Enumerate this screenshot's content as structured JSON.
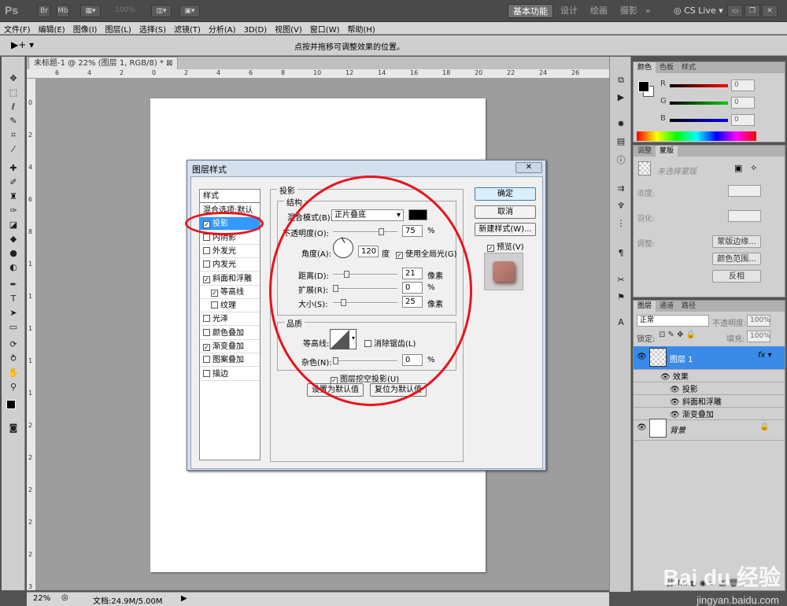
{
  "app": {
    "logo": "Ps",
    "zoom_selector": "100%",
    "workspaces": [
      "基本功能",
      "设计",
      "绘画",
      "摄影"
    ],
    "cs_live": "CS Live"
  },
  "menu": [
    "文件(F)",
    "编辑(E)",
    "图像(I)",
    "图层(L)",
    "选择(S)",
    "滤镜(T)",
    "分析(A)",
    "3D(D)",
    "视图(V)",
    "窗口(W)",
    "帮助(H)"
  ],
  "options_bar": {
    "hint": "点按并拖移可调整效果的位置。"
  },
  "document": {
    "tab_title": "未标题-1 @ 22% (图层 1, RGB/8) *",
    "ruler_h": [
      "6",
      "4",
      "2",
      "0",
      "2",
      "4",
      "6",
      "8",
      "10",
      "12",
      "14",
      "16",
      "18",
      "20",
      "22",
      "24",
      "26"
    ],
    "ruler_v": [
      "0",
      "2",
      "4",
      "6",
      "8",
      "1",
      "1",
      "1",
      "1",
      "1",
      "2",
      "2",
      "2",
      "2",
      "2",
      "3"
    ]
  },
  "status": {
    "zoom": "22%",
    "doc": "文档:24.9M/5.00M"
  },
  "dialog": {
    "title": "图层样式",
    "styles_header": "样式",
    "styles": [
      {
        "label": "混合选项:默认",
        "check": false,
        "has_box": false
      },
      {
        "label": "投影",
        "check": true,
        "has_box": true,
        "selected": true
      },
      {
        "label": "内阴影",
        "check": false,
        "has_box": true
      },
      {
        "label": "外发光",
        "check": false,
        "has_box": true
      },
      {
        "label": "内发光",
        "check": false,
        "has_box": true
      },
      {
        "label": "斜面和浮雕",
        "check": true,
        "has_box": true
      },
      {
        "label": "等高线",
        "check": true,
        "has_box": true,
        "indent": true
      },
      {
        "label": "纹理",
        "check": false,
        "has_box": true,
        "indent": true
      },
      {
        "label": "光泽",
        "check": false,
        "has_box": true
      },
      {
        "label": "颜色叠加",
        "check": false,
        "has_box": true
      },
      {
        "label": "渐变叠加",
        "check": true,
        "has_box": true
      },
      {
        "label": "图案叠加",
        "check": false,
        "has_box": true
      },
      {
        "label": "描边",
        "check": false,
        "has_box": true
      }
    ],
    "section_title": "投影",
    "structure": {
      "title": "结构",
      "blend_label": "混合模式(B):",
      "blend_value": "正片叠底",
      "opacity_label": "不透明度(O):",
      "opacity_value": "75",
      "percent": "%",
      "angle_label": "角度(A):",
      "angle_value": "120",
      "degree": "度",
      "global_light": "使用全局光(G)",
      "distance_label": "距离(D):",
      "distance_value": "21",
      "spread_label": "扩展(R):",
      "spread_value": "0",
      "size_label": "大小(S):",
      "size_value": "25",
      "px": "像素"
    },
    "quality": {
      "title": "品质",
      "contour_label": "等高线:",
      "antialias": "消除锯齿(L)",
      "noise_label": "杂色(N):",
      "noise_value": "0"
    },
    "knockout": "图层挖空投影(U)",
    "make_default": "设置为默认值",
    "reset_default": "复位为默认值",
    "buttons": {
      "ok": "确定",
      "cancel": "取消",
      "new_style": "新建样式(W)...",
      "preview": "预览(V)"
    }
  },
  "panels": {
    "color": {
      "tabs": [
        "颜色",
        "色板",
        "样式"
      ],
      "r": "R",
      "g": "G",
      "b": "B",
      "r_val": "0",
      "g_val": "0",
      "b_val": "0"
    },
    "adjust": {
      "tabs": [
        "调整",
        "蒙版"
      ],
      "no_mask": "未选择蒙版",
      "density": "浓度:",
      "feather": "羽化:",
      "refine": "调整:",
      "mask_edge": "蒙版边缘...",
      "color_range": "颜色范围...",
      "invert": "反相"
    },
    "layers": {
      "tabs": [
        "图层",
        "通道",
        "路径"
      ],
      "blend": "正常",
      "opacity_label": "不透明度:",
      "opacity": "100%",
      "lock": "锁定:",
      "fill_label": "填充:",
      "fill": "100%",
      "layer1": "图层 1",
      "effects": "效果",
      "fx_items": [
        "投影",
        "斜面和浮雕",
        "渐变叠加"
      ],
      "background": "背景"
    }
  },
  "watermark": {
    "brand": "Bai du 经验",
    "url": "jingyan.baidu.com"
  }
}
